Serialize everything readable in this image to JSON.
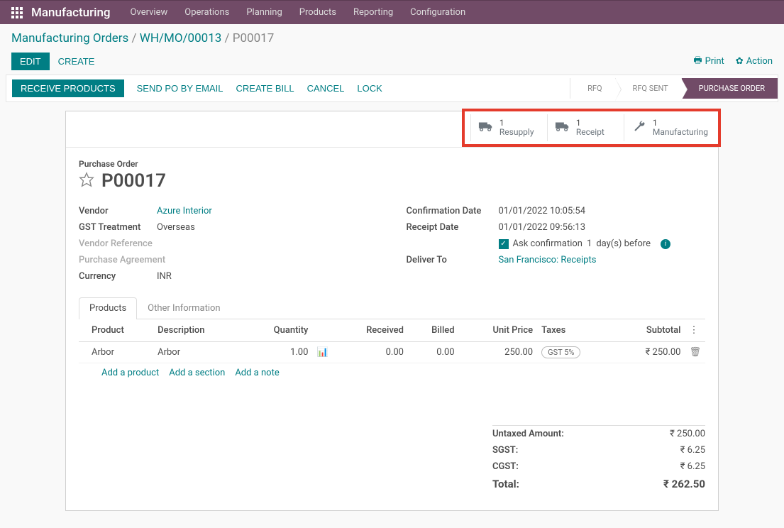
{
  "topbar": {
    "app_name": "Manufacturing",
    "menu": [
      "Overview",
      "Operations",
      "Planning",
      "Products",
      "Reporting",
      "Configuration"
    ]
  },
  "breadcrumb": {
    "a": "Manufacturing Orders",
    "b": "WH/MO/00013",
    "current": "P00017"
  },
  "actions": {
    "edit": "EDIT",
    "create": "CREATE",
    "print": "Print",
    "action": "Action"
  },
  "status_buttons": {
    "receive": "RECEIVE PRODUCTS",
    "send_po": "SEND PO BY EMAIL",
    "create_bill": "CREATE BILL",
    "cancel": "CANCEL",
    "lock": "LOCK"
  },
  "status_steps": {
    "rfq": "RFQ",
    "rfq_sent": "RFQ SENT",
    "po": "PURCHASE ORDER"
  },
  "stat": {
    "resupply_n": "1",
    "resupply_t": "Resupply",
    "receipt_n": "1",
    "receipt_t": "Receipt",
    "mfg_n": "1",
    "mfg_t": "Manufacturing"
  },
  "header": {
    "label": "Purchase Order",
    "name": "P00017"
  },
  "fields": {
    "vendor_l": "Vendor",
    "vendor_v": "Azure Interior",
    "gst_l": "GST Treatment",
    "gst_v": "Overseas",
    "vref_l": "Vendor Reference",
    "pagr_l": "Purchase Agreement",
    "curr_l": "Currency",
    "curr_v": "INR",
    "conf_l": "Confirmation Date",
    "conf_v": "01/01/2022 10:05:54",
    "rcpt_l": "Receipt Date",
    "rcpt_v": "01/01/2022 09:56:13",
    "ask_text": "Ask confirmation",
    "ask_days": "1",
    "ask_suffix": "day(s) before",
    "deliver_l": "Deliver To",
    "deliver_v": "San Francisco: Receipts"
  },
  "tabs": {
    "products": "Products",
    "other": "Other Information"
  },
  "table": {
    "h_product": "Product",
    "h_desc": "Description",
    "h_qty": "Quantity",
    "h_recv": "Received",
    "h_billed": "Billed",
    "h_price": "Unit Price",
    "h_taxes": "Taxes",
    "h_subtotal": "Subtotal",
    "row": {
      "product": "Arbor",
      "desc": "Arbor",
      "qty": "1.00",
      "recv": "0.00",
      "billed": "0.00",
      "price": "250.00",
      "tax": "GST 5%",
      "subtotal": "₹ 250.00"
    },
    "add_product": "Add a product",
    "add_section": "Add a section",
    "add_note": "Add a note"
  },
  "totals": {
    "untaxed_l": "Untaxed Amount:",
    "untaxed_v": "₹ 250.00",
    "sgst_l": "SGST:",
    "sgst_v": "₹ 6.25",
    "cgst_l": "CGST:",
    "cgst_v": "₹ 6.25",
    "total_l": "Total:",
    "total_v": "₹ 262.50"
  }
}
